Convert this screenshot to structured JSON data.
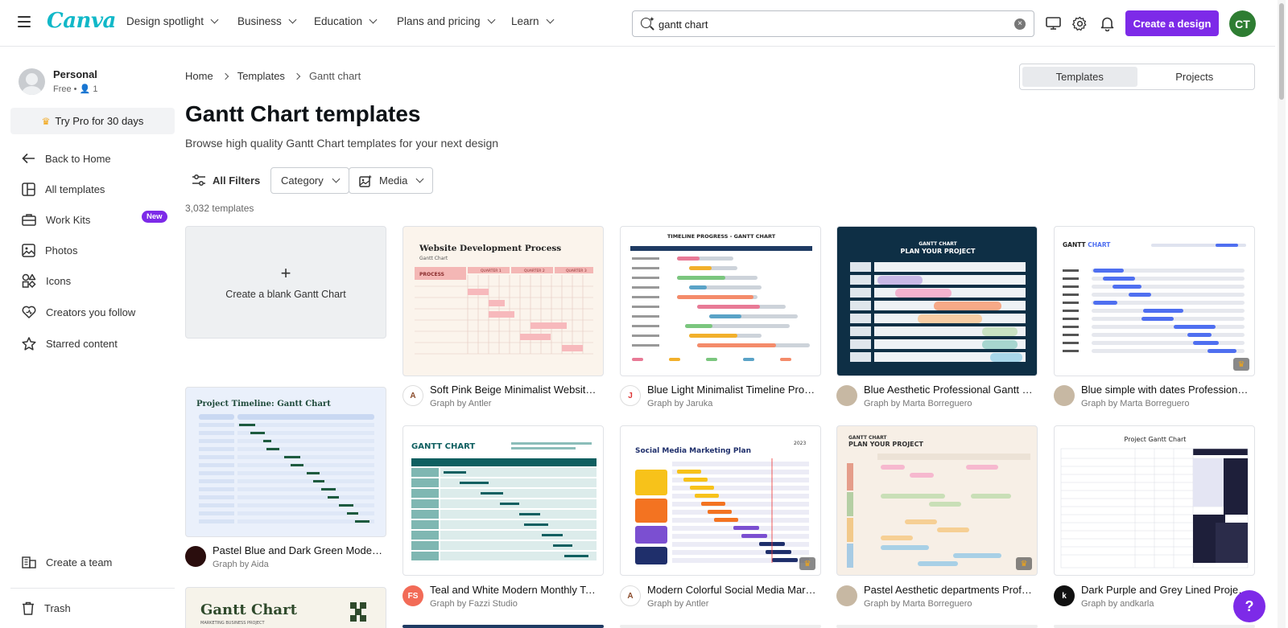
{
  "brand": {
    "logo": "Canva",
    "accent": "#7d2ae8",
    "logo_color": "#11b8c8"
  },
  "nav": {
    "items": [
      {
        "label": "Design spotlight"
      },
      {
        "label": "Business"
      },
      {
        "label": "Education"
      },
      {
        "label": "Plans and pricing"
      },
      {
        "label": "Learn"
      }
    ],
    "search_value": "gantt chart",
    "create_label": "Create a design",
    "avatar_initials": "CT"
  },
  "sidebar": {
    "account_name": "Personal",
    "account_plan": "Free • ",
    "account_members": "1",
    "try_pro": "Try Pro for 30 days",
    "items": [
      {
        "label": "Back to Home",
        "icon": "arrow-left-icon"
      },
      {
        "label": "All templates",
        "icon": "templates-icon"
      },
      {
        "label": "Work Kits",
        "icon": "briefcase-icon",
        "badge": "New"
      },
      {
        "label": "Photos",
        "icon": "photo-icon"
      },
      {
        "label": "Icons",
        "icon": "shapes-icon"
      },
      {
        "label": "Creators you follow",
        "icon": "heart-icon"
      },
      {
        "label": "Starred content",
        "icon": "star-icon"
      }
    ],
    "bottom": [
      {
        "label": "Create a team",
        "icon": "team-icon"
      },
      {
        "label": "Trash",
        "icon": "trash-icon"
      }
    ]
  },
  "breadcrumb": [
    "Home",
    "Templates",
    "Gantt chart"
  ],
  "toggle": {
    "left": "Templates",
    "right": "Projects"
  },
  "page": {
    "title": "Gantt Chart templates",
    "subtitle": "Browse high quality Gantt Chart templates for your next design",
    "count": "3,032 templates"
  },
  "filters": {
    "all": "All Filters",
    "category": "Category",
    "media": "Media"
  },
  "blank_card": "Create a blank Gantt Chart",
  "templates": [
    {
      "title": "Soft Pink Beige Minimalist Website ...",
      "author": "Graph by Antler"
    },
    {
      "title": "Blue Light Minimalist Timeline Progr...",
      "author": "Graph by Jaruka"
    },
    {
      "title": "Blue Aesthetic Professional Gantt Gr...",
      "author": "Graph by Marta Borreguero"
    },
    {
      "title": "Blue simple with dates Professional ...",
      "author": "Graph by Marta Borreguero"
    },
    {
      "title": "Pastel Blue and Dark Green Modern ...",
      "author": "Graph by Aida"
    },
    {
      "title": "Teal and White Modern Monthly Tas...",
      "author": "Graph by Fazzi Studio"
    },
    {
      "title": "Modern Colorful Social Media Marke...",
      "author": "Graph by Antler"
    },
    {
      "title": "Pastel Aesthetic departments Profes...",
      "author": "Graph by Marta Borreguero"
    },
    {
      "title": "Dark Purple and Grey Lined Project ...",
      "author": "Graph by andkarla"
    }
  ],
  "thumbs": {
    "t1": {
      "title": "Website Development Process",
      "sub": "Gantt Chart",
      "col": "PROCESS",
      "q1": "QUARTER 1",
      "q2": "QUARTER 2",
      "q3": "QUARTER 3"
    },
    "t2": {
      "title": "TIMELINE PROGRESS - GANTT CHART"
    },
    "t3": {
      "title": "GANTT CHART",
      "sub": "PLAN YOUR PROJECT"
    },
    "t4": {
      "title": "GANTT ",
      "title2": "CHART"
    },
    "t5": {
      "title": "Project Timeline: Gantt Chart"
    },
    "t6": {
      "title": "GANTT CHART"
    },
    "t7": {
      "title": "Social Media Marketing Plan",
      "year": "2023"
    },
    "t8": {
      "title": "GANTT CHART",
      "sub": "PLAN YOUR PROJECT"
    },
    "t9": {
      "title": "Project Gantt Chart"
    },
    "t10": {
      "title": "Gantt Chart",
      "sub": "MARKETING BUSINESS PROJECT"
    }
  },
  "help_label": "?"
}
